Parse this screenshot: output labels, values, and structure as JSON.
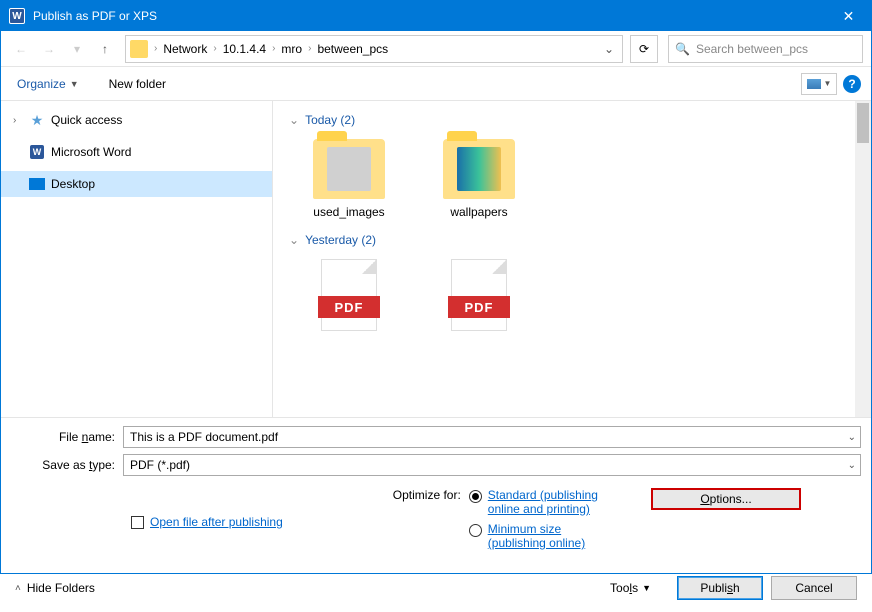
{
  "titlebar": {
    "app_icon_letter": "W",
    "title": "Publish as PDF or XPS"
  },
  "address": {
    "segments": [
      "Network",
      "10.1.4.4",
      "mro",
      "between_pcs"
    ]
  },
  "search": {
    "placeholder": "Search between_pcs"
  },
  "toolbar": {
    "organize": "Organize",
    "new_folder": "New folder"
  },
  "sidebar": {
    "items": [
      {
        "label": "Quick access"
      },
      {
        "label": "Microsoft Word"
      },
      {
        "label": "Desktop"
      }
    ]
  },
  "groups": [
    {
      "header": "Today (2)",
      "items": [
        {
          "label": "used_images",
          "kind": "folder"
        },
        {
          "label": "wallpapers",
          "kind": "folder-wall"
        }
      ]
    },
    {
      "header": "Yesterday (2)",
      "items": [
        {
          "label": "",
          "kind": "pdf"
        },
        {
          "label": "",
          "kind": "pdf"
        }
      ]
    }
  ],
  "form": {
    "filename_label_pre": "File ",
    "filename_label_ul": "n",
    "filename_label_post": "ame:",
    "filename_value": "This is a PDF document.pdf",
    "savetype_label_pre": "Save as ",
    "savetype_label_ul": "t",
    "savetype_label_post": "ype:",
    "savetype_value": "PDF (*.pdf)",
    "open_after_pre": "Op",
    "open_after_ul": "e",
    "open_after_post": "n file after publishing",
    "optimize_label": "Optimize for:",
    "radio1_pre": "Standard (publishin",
    "radio1_ul": "g",
    "radio1_post": "",
    "radio1_line2": "online and printing)",
    "radio2_pre": "",
    "radio2_ul": "M",
    "radio2_post": "inimum size",
    "radio2_line2": "(publishing online)",
    "options_btn_pre": "",
    "options_btn_ul": "O",
    "options_btn_post": "ptions..."
  },
  "footer": {
    "hide_folders": "Hide Folders",
    "tools_pre": "Too",
    "tools_ul": "l",
    "tools_post": "s",
    "publish_pre": "Publi",
    "publish_ul": "s",
    "publish_post": "h",
    "cancel": "Cancel"
  },
  "misc": {
    "pdf_band": "PDF",
    "help": "?"
  }
}
